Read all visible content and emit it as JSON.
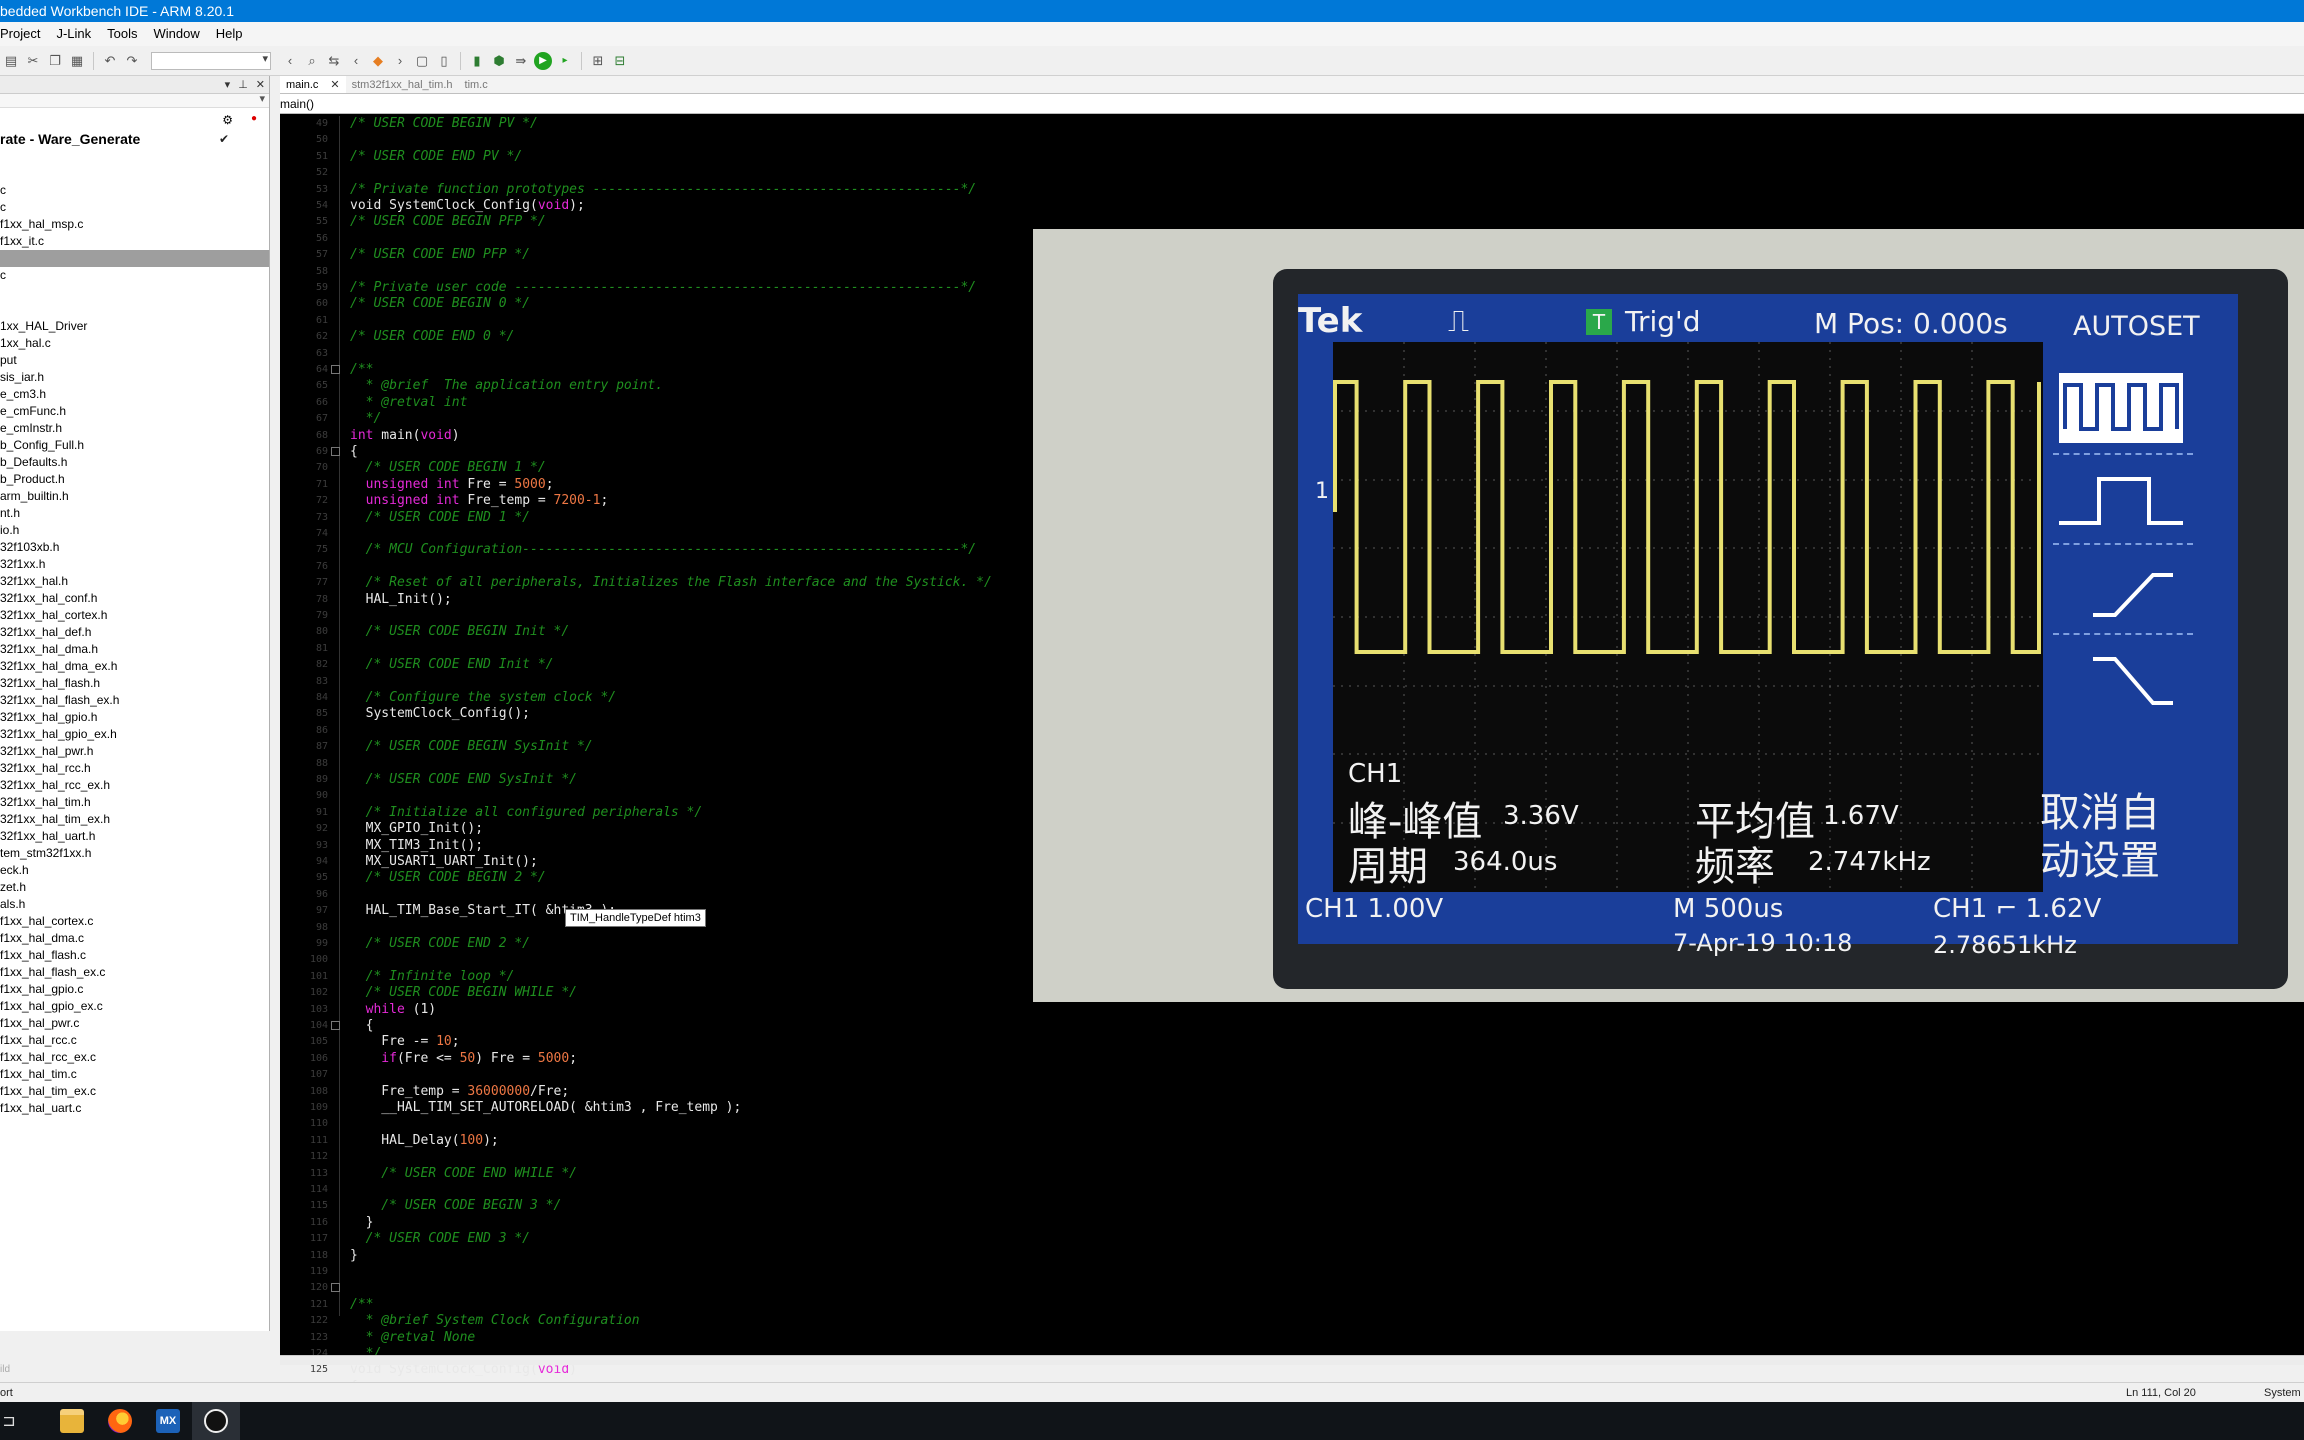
{
  "window": {
    "title": "bedded Workbench IDE - ARM 8.20.1"
  },
  "menu": [
    "Project",
    "J-Link",
    "Tools",
    "Window",
    "Help"
  ],
  "workspace": {
    "project": "rate - Ware_Generate",
    "files": [
      "",
      "",
      "c",
      "c",
      "f1xx_hal_msp.c",
      "f1xx_it.c",
      "",
      "c",
      "",
      "",
      "1xx_HAL_Driver",
      "1xx_hal.c",
      "put",
      "sis_iar.h",
      "e_cm3.h",
      "e_cmFunc.h",
      "e_cmInstr.h",
      "b_Config_Full.h",
      "b_Defaults.h",
      "b_Product.h",
      "arm_builtin.h",
      "nt.h",
      "io.h",
      "32f103xb.h",
      "32f1xx.h",
      "32f1xx_hal.h",
      "32f1xx_hal_conf.h",
      "32f1xx_hal_cortex.h",
      "32f1xx_hal_def.h",
      "32f1xx_hal_dma.h",
      "32f1xx_hal_dma_ex.h",
      "32f1xx_hal_flash.h",
      "32f1xx_hal_flash_ex.h",
      "32f1xx_hal_gpio.h",
      "32f1xx_hal_gpio_ex.h",
      "32f1xx_hal_pwr.h",
      "32f1xx_hal_rcc.h",
      "32f1xx_hal_rcc_ex.h",
      "32f1xx_hal_tim.h",
      "32f1xx_hal_tim_ex.h",
      "32f1xx_hal_uart.h",
      "tem_stm32f1xx.h",
      "eck.h",
      "zet.h",
      "als.h",
      "f1xx_hal_cortex.c",
      "f1xx_hal_dma.c",
      "f1xx_hal_flash.c",
      "f1xx_hal_flash_ex.c",
      "f1xx_hal_gpio.c",
      "f1xx_hal_gpio_ex.c",
      "f1xx_hal_pwr.c",
      "f1xx_hal_rcc.c",
      "f1xx_hal_rcc_ex.c",
      "f1xx_hal_tim.c",
      "f1xx_hal_tim_ex.c",
      "f1xx_hal_uart.c"
    ]
  },
  "tabs": [
    "main.c",
    "stm32f1xx_hal_tim.h",
    "tim.c"
  ],
  "function_bar": "main()",
  "code": [
    [
      [
        "c-cm",
        "/* USER CODE BEGIN PV */"
      ]
    ],
    [],
    [
      [
        "c-cm",
        "/* USER CODE END PV */"
      ]
    ],
    [],
    [
      [
        "c-cm",
        "/* Private function prototypes -----------------------------------------------*/"
      ]
    ],
    [
      [
        "c-pl",
        "void SystemClock_Config("
      ],
      [
        "c-kw",
        "void"
      ],
      [
        "c-pl",
        ");"
      ]
    ],
    [
      [
        "c-cm",
        "/* USER CODE BEGIN PFP */"
      ]
    ],
    [],
    [
      [
        "c-cm",
        "/* USER CODE END PFP */"
      ]
    ],
    [],
    [
      [
        "c-cm",
        "/* Private user code ---------------------------------------------------------*/"
      ]
    ],
    [
      [
        "c-cm",
        "/* USER CODE BEGIN 0 */"
      ]
    ],
    [],
    [
      [
        "c-cm",
        "/* USER CODE END 0 */"
      ]
    ],
    [],
    [
      [
        "c-cm",
        "/**"
      ]
    ],
    [
      [
        "c-cm",
        "  * @brief  The application entry point."
      ]
    ],
    [
      [
        "c-cm",
        "  * @retval int"
      ]
    ],
    [
      [
        "c-cm",
        "  */"
      ]
    ],
    [
      [
        "c-kw",
        "int"
      ],
      [
        "c-pl",
        " main("
      ],
      [
        "c-kw",
        "void"
      ],
      [
        "c-pl",
        ")"
      ]
    ],
    [
      [
        "c-pl",
        "{"
      ]
    ],
    [
      [
        "c-cm",
        "  /* USER CODE BEGIN 1 */"
      ]
    ],
    [
      [
        "c-kw",
        "  unsigned int"
      ],
      [
        "c-pl",
        " Fre = "
      ],
      [
        "c-n",
        "5000"
      ],
      [
        "c-pl",
        ";"
      ]
    ],
    [
      [
        "c-kw",
        "  unsigned int"
      ],
      [
        "c-pl",
        " Fre_temp = "
      ],
      [
        "c-n",
        "7200-1"
      ],
      [
        "c-pl",
        ";"
      ]
    ],
    [
      [
        "c-cm",
        "  /* USER CODE END 1 */"
      ]
    ],
    [],
    [
      [
        "c-cm",
        "  /* MCU Configuration--------------------------------------------------------*/"
      ]
    ],
    [],
    [
      [
        "c-cm",
        "  /* Reset of all peripherals, Initializes the Flash interface and the Systick. */"
      ]
    ],
    [
      [
        "c-pl",
        "  HAL_Init();"
      ]
    ],
    [],
    [
      [
        "c-cm",
        "  /* USER CODE BEGIN Init */"
      ]
    ],
    [],
    [
      [
        "c-cm",
        "  /* USER CODE END Init */"
      ]
    ],
    [],
    [
      [
        "c-cm",
        "  /* Configure the system clock */"
      ]
    ],
    [
      [
        "c-pl",
        "  SystemClock_Config();"
      ]
    ],
    [],
    [
      [
        "c-cm",
        "  /* USER CODE BEGIN SysInit */"
      ]
    ],
    [],
    [
      [
        "c-cm",
        "  /* USER CODE END SysInit */"
      ]
    ],
    [],
    [
      [
        "c-cm",
        "  /* Initialize all configured peripherals */"
      ]
    ],
    [
      [
        "c-pl",
        "  MX_GPIO_Init();"
      ]
    ],
    [
      [
        "c-pl",
        "  MX_TIM3_Init();"
      ]
    ],
    [
      [
        "c-pl",
        "  MX_USART1_UART_Init();"
      ]
    ],
    [
      [
        "c-cm",
        "  /* USER CODE BEGIN 2 */"
      ]
    ],
    [],
    [
      [
        "c-pl",
        "  HAL_TIM_Base_Start_IT( &htim3 );"
      ]
    ],
    [],
    [
      [
        "c-cm",
        "  /* USER CODE END 2 */"
      ]
    ],
    [],
    [
      [
        "c-cm",
        "  /* Infinite loop */"
      ]
    ],
    [
      [
        "c-cm",
        "  /* USER CODE BEGIN WHILE */"
      ]
    ],
    [
      [
        "c-kw",
        "  while"
      ],
      [
        "c-pl",
        " (1)"
      ]
    ],
    [
      [
        "c-pl",
        "  {"
      ]
    ],
    [
      [
        "c-pl",
        "    Fre -= "
      ],
      [
        "c-n",
        "10"
      ],
      [
        "c-pl",
        ";"
      ]
    ],
    [
      [
        "c-kw",
        "    if"
      ],
      [
        "c-pl",
        "(Fre <= "
      ],
      [
        "c-n",
        "50"
      ],
      [
        "c-pl",
        ") Fre = "
      ],
      [
        "c-n",
        "5000"
      ],
      [
        "c-pl",
        ";"
      ]
    ],
    [],
    [
      [
        "c-pl",
        "    Fre_temp = "
      ],
      [
        "c-n",
        "36000000"
      ],
      [
        "c-pl",
        "/Fre;"
      ]
    ],
    [
      [
        "c-pl",
        "    __HAL_TIM_SET_AUTORELOAD( &htim3 , Fre_temp );"
      ]
    ],
    [],
    [
      [
        "c-pl",
        "    HAL_Delay("
      ],
      [
        "c-n",
        "100"
      ],
      [
        "c-pl",
        ");"
      ]
    ],
    [],
    [
      [
        "c-cm",
        "    /* USER CODE END WHILE */"
      ]
    ],
    [],
    [
      [
        "c-cm",
        "    /* USER CODE BEGIN 3 */"
      ]
    ],
    [
      [
        "c-pl",
        "  }"
      ]
    ],
    [
      [
        "c-cm",
        "  /* USER CODE END 3 */"
      ]
    ],
    [
      [
        "c-pl",
        "}"
      ]
    ],
    [],
    [],
    [
      [
        "c-cm",
        "/**"
      ]
    ],
    [
      [
        "c-cm",
        "  * @brief System Clock Configuration"
      ]
    ],
    [
      [
        "c-cm",
        "  * @retval None"
      ]
    ],
    [
      [
        "c-cm",
        "  */"
      ]
    ],
    [
      [
        "c-pl",
        "void SystemClock_Config("
      ],
      [
        "c-kw",
        "void"
      ],
      [
        "c-pl",
        ")"
      ]
    ],
    [
      [
        "c-pl",
        "{"
      ]
    ]
  ],
  "tooltip": "TIM_HandleTypeDef htim3",
  "status": {
    "left": "ort",
    "position": "Ln 111, Col 20",
    "mode": "System",
    "build_stub": "ild"
  },
  "oscilloscope": {
    "brand": "Tek",
    "trig_status": "Trig'd",
    "m_pos": "M Pos: 0.000s",
    "autoset": "AUTOSET",
    "ch_label": "CH1",
    "pkpk_label": "峰-峰值",
    "pkpk_value": "3.36V",
    "mean_label": "平均值",
    "mean_value": "1.67V",
    "period_label": "周期",
    "period_value": "364.0us",
    "freq_label": "频率",
    "freq_value": "2.747kHz",
    "cancel_autoset": "取消自动设置",
    "ch1_scale": "CH1  1.00V",
    "timebase": "M 500us",
    "trigger": "CH1 ⌐ 1.62V",
    "date": "7-Apr-19 10:18",
    "trig_freq": "2.78651kHz",
    "trace_marker": "1"
  },
  "colors": {
    "accent": "#0078d7",
    "comment": "#1f8f1f",
    "keyword": "#e52ad8",
    "number": "#ee7744",
    "trace": "#e8e070"
  }
}
